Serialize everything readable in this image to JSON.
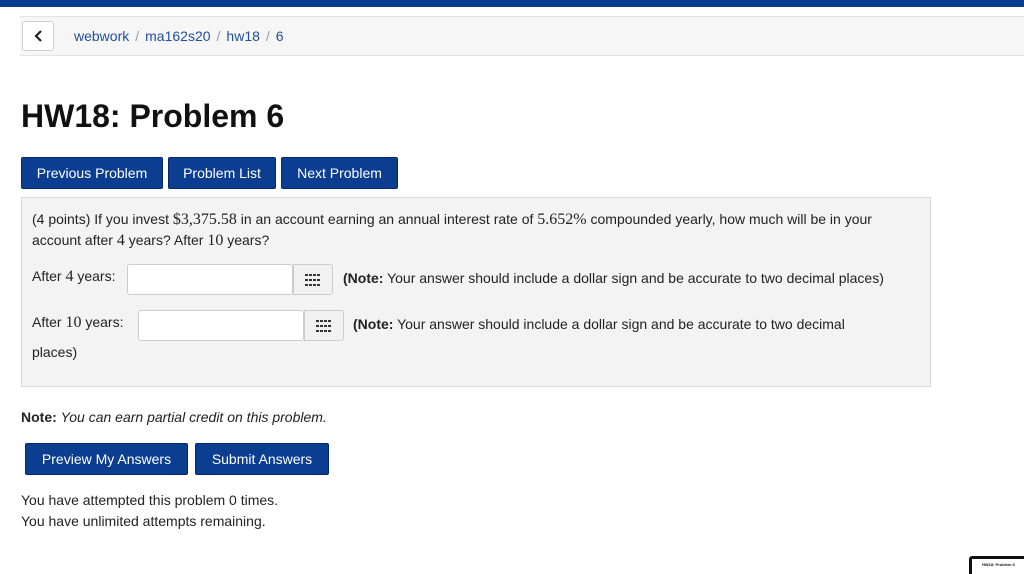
{
  "breadcrumb": {
    "items": [
      "webwork",
      "ma162s20",
      "hw18"
    ],
    "current": "6",
    "separator": "/"
  },
  "page_title": "HW18: Problem 6",
  "nav_buttons": {
    "previous": "Previous Problem",
    "list": "Problem List",
    "next": "Next Problem"
  },
  "problem": {
    "points": "(4 points)",
    "text_1": "If you invest",
    "principal": "$3,375.58",
    "text_2": "in an account earning an annual interest rate of",
    "rate": "5.652%",
    "text_3": "compounded yearly, how much will be in your account after",
    "years_1": "4",
    "text_4": "years? After",
    "years_2": "10",
    "text_5": "years?"
  },
  "answers": [
    {
      "label_prefix": "After",
      "years": "4",
      "label_suffix": "years:",
      "value": "",
      "note_bold": "(Note:",
      "note_rest": "Your answer should include a dollar sign and be accurate to two decimal places)"
    },
    {
      "label_prefix": "After",
      "years": "10",
      "label_suffix": "years:",
      "value": "",
      "note_bold": "(Note:",
      "note_rest": "Your answer should include a dollar sign and be accurate to two decimal",
      "note_wrap": "places)"
    }
  ],
  "credit_note": {
    "bold": "Note:",
    "italic": "You can earn partial credit on this problem."
  },
  "action_buttons": {
    "preview": "Preview My Answers",
    "submit": "Submit Answers"
  },
  "attempts": {
    "line_1": "You have attempted this problem 0 times.",
    "line_2": "You have unlimited attempts remaining."
  },
  "thumbnail_label": "HW18: Problem 6",
  "colors": {
    "primary": "#0b3d91",
    "link": "#1f4e9c",
    "panel": "#f3f3f3"
  }
}
